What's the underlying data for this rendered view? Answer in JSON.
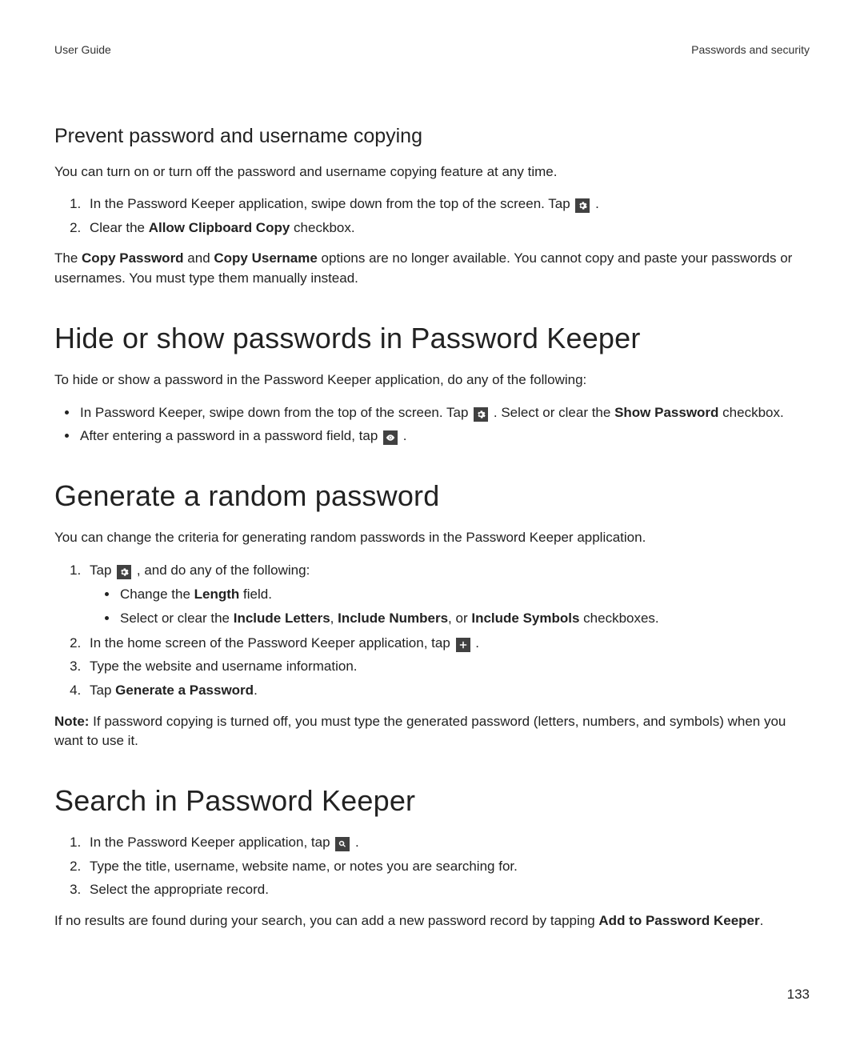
{
  "header": {
    "left": "User Guide",
    "right": "Passwords and security"
  },
  "page_number": "133",
  "sec1": {
    "title": "Prevent password and username copying",
    "intro": "You can turn on or turn off the password and username copying feature at any time.",
    "step1_a": "In the Password Keeper application, swipe down from the top of the screen. Tap ",
    "step1_b": " .",
    "step2_a": "Clear the ",
    "step2_bold": "Allow Clipboard Copy",
    "step2_b": " checkbox.",
    "outro_a": "The ",
    "outro_bold1": "Copy Password",
    "outro_b": " and ",
    "outro_bold2": "Copy Username",
    "outro_c": " options are no longer available. You cannot copy and paste your passwords or usernames. You must type them manually instead."
  },
  "sec2": {
    "title": "Hide or show passwords in Password Keeper",
    "intro": "To hide or show a password in the Password Keeper application, do any of the following:",
    "b1_a": "In Password Keeper, swipe down from the top of the screen. Tap ",
    "b1_b": " . Select or clear the ",
    "b1_bold": "Show Password",
    "b1_c": " checkbox.",
    "b2_a": "After entering a password in a password field, tap ",
    "b2_b": " ."
  },
  "sec3": {
    "title": "Generate a random password",
    "intro": "You can change the criteria for generating random passwords in the Password Keeper application.",
    "s1_a": "Tap ",
    "s1_b": " , and do any of the following:",
    "s1_sub1_a": "Change the ",
    "s1_sub1_bold": "Length",
    "s1_sub1_b": " field.",
    "s1_sub2_a": "Select or clear the ",
    "s1_sub2_bold1": "Include Letters",
    "s1_sub2_sep": ", ",
    "s1_sub2_bold2": "Include Numbers",
    "s1_sub2_sep2": ", or ",
    "s1_sub2_bold3": "Include Symbols",
    "s1_sub2_b": " checkboxes.",
    "s2_a": "In the home screen of the Password Keeper application, tap ",
    "s2_b": " .",
    "s3": "Type the website and username information.",
    "s4_a": "Tap ",
    "s4_bold": "Generate a Password",
    "s4_b": ".",
    "note_label": "Note:",
    "note_body": " If password copying is turned off, you must type the generated password (letters, numbers, and symbols) when you want to use it."
  },
  "sec4": {
    "title": "Search in Password Keeper",
    "s1_a": "In the Password Keeper application, tap ",
    "s1_b": " .",
    "s2": "Type the title, username, website name, or notes you are searching for.",
    "s3": "Select the appropriate record.",
    "outro_a": "If no results are found during your search, you can add a new password record by tapping ",
    "outro_bold": "Add to Password Keeper",
    "outro_b": "."
  }
}
